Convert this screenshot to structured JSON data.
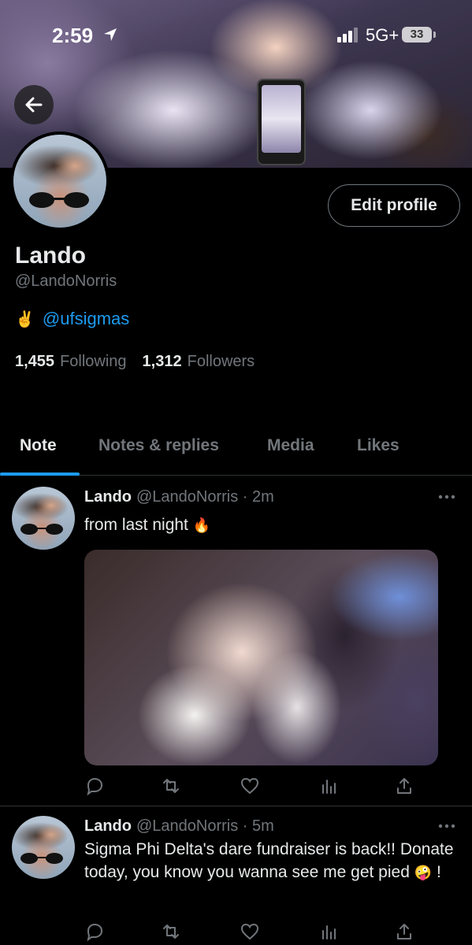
{
  "status_bar": {
    "time": "2:59",
    "network": "5G+",
    "battery": "33"
  },
  "profile": {
    "display_name": "Lando",
    "handle": "@LandoNorris",
    "bio_emoji": "✌️",
    "bio_mention": "@ufsigmas",
    "following_count": "1,455",
    "following_label": "Following",
    "followers_count": "1,312",
    "followers_label": "Followers",
    "edit_profile_label": "Edit profile"
  },
  "tabs": [
    {
      "label": "Note",
      "active": true
    },
    {
      "label": "Notes & replies",
      "active": false
    },
    {
      "label": "Media",
      "active": false
    },
    {
      "label": "Likes",
      "active": false
    }
  ],
  "posts": [
    {
      "name": "Lando",
      "handle": "@LandoNorris",
      "time": "2m",
      "text": "from last night",
      "emoji": "🔥",
      "has_media": true
    },
    {
      "name": "Lando",
      "handle": "@LandoNorris",
      "time": "5m",
      "text": "Sigma Phi Delta's dare fundraiser is back!! Donate today, you know you wanna see me get pied",
      "emoji": "🤪",
      "text_end": " !",
      "has_media": false
    }
  ],
  "colors": {
    "accent": "#1d9bf0",
    "muted": "#71767b",
    "background": "#000000"
  },
  "icons": [
    "location-arrow-icon",
    "signal-icon",
    "back-arrow-icon",
    "more-icon",
    "reply-icon",
    "retweet-icon",
    "like-icon",
    "views-icon",
    "share-icon"
  ]
}
